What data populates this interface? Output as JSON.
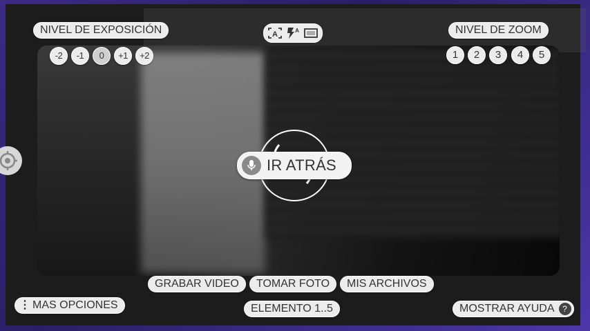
{
  "exposure": {
    "label": "NIVEL DE EXPOSICIÓN",
    "levels": [
      "-2",
      "-1",
      "0",
      "+1",
      "+2"
    ],
    "selected": "0"
  },
  "camera_modes": {
    "icons": [
      "auto-focus-icon",
      "flash-auto-icon",
      "aspect-ratio-icon"
    ]
  },
  "zoom": {
    "label": "NIVEL DE ZOOM",
    "levels": [
      "1",
      "2",
      "3",
      "4",
      "5"
    ]
  },
  "center": {
    "go_back_label": "IR ATRÁS",
    "mic_icon": "mic-icon"
  },
  "bottom": {
    "record_video": "GRABAR VIDEO",
    "take_photo": "TOMAR FOTO",
    "my_files": "MIS ARCHIVOS",
    "element_range": "ELEMENTO 1..5",
    "more_options": "MAS OPCIONES",
    "show_help": "MOSTRAR AYUDA",
    "help_symbol": "?"
  },
  "colors": {
    "pill_bg": "#ececec",
    "pill_text": "#333333",
    "frame_bg": "#1c1c1c",
    "background_purple": "#3b2a86"
  }
}
